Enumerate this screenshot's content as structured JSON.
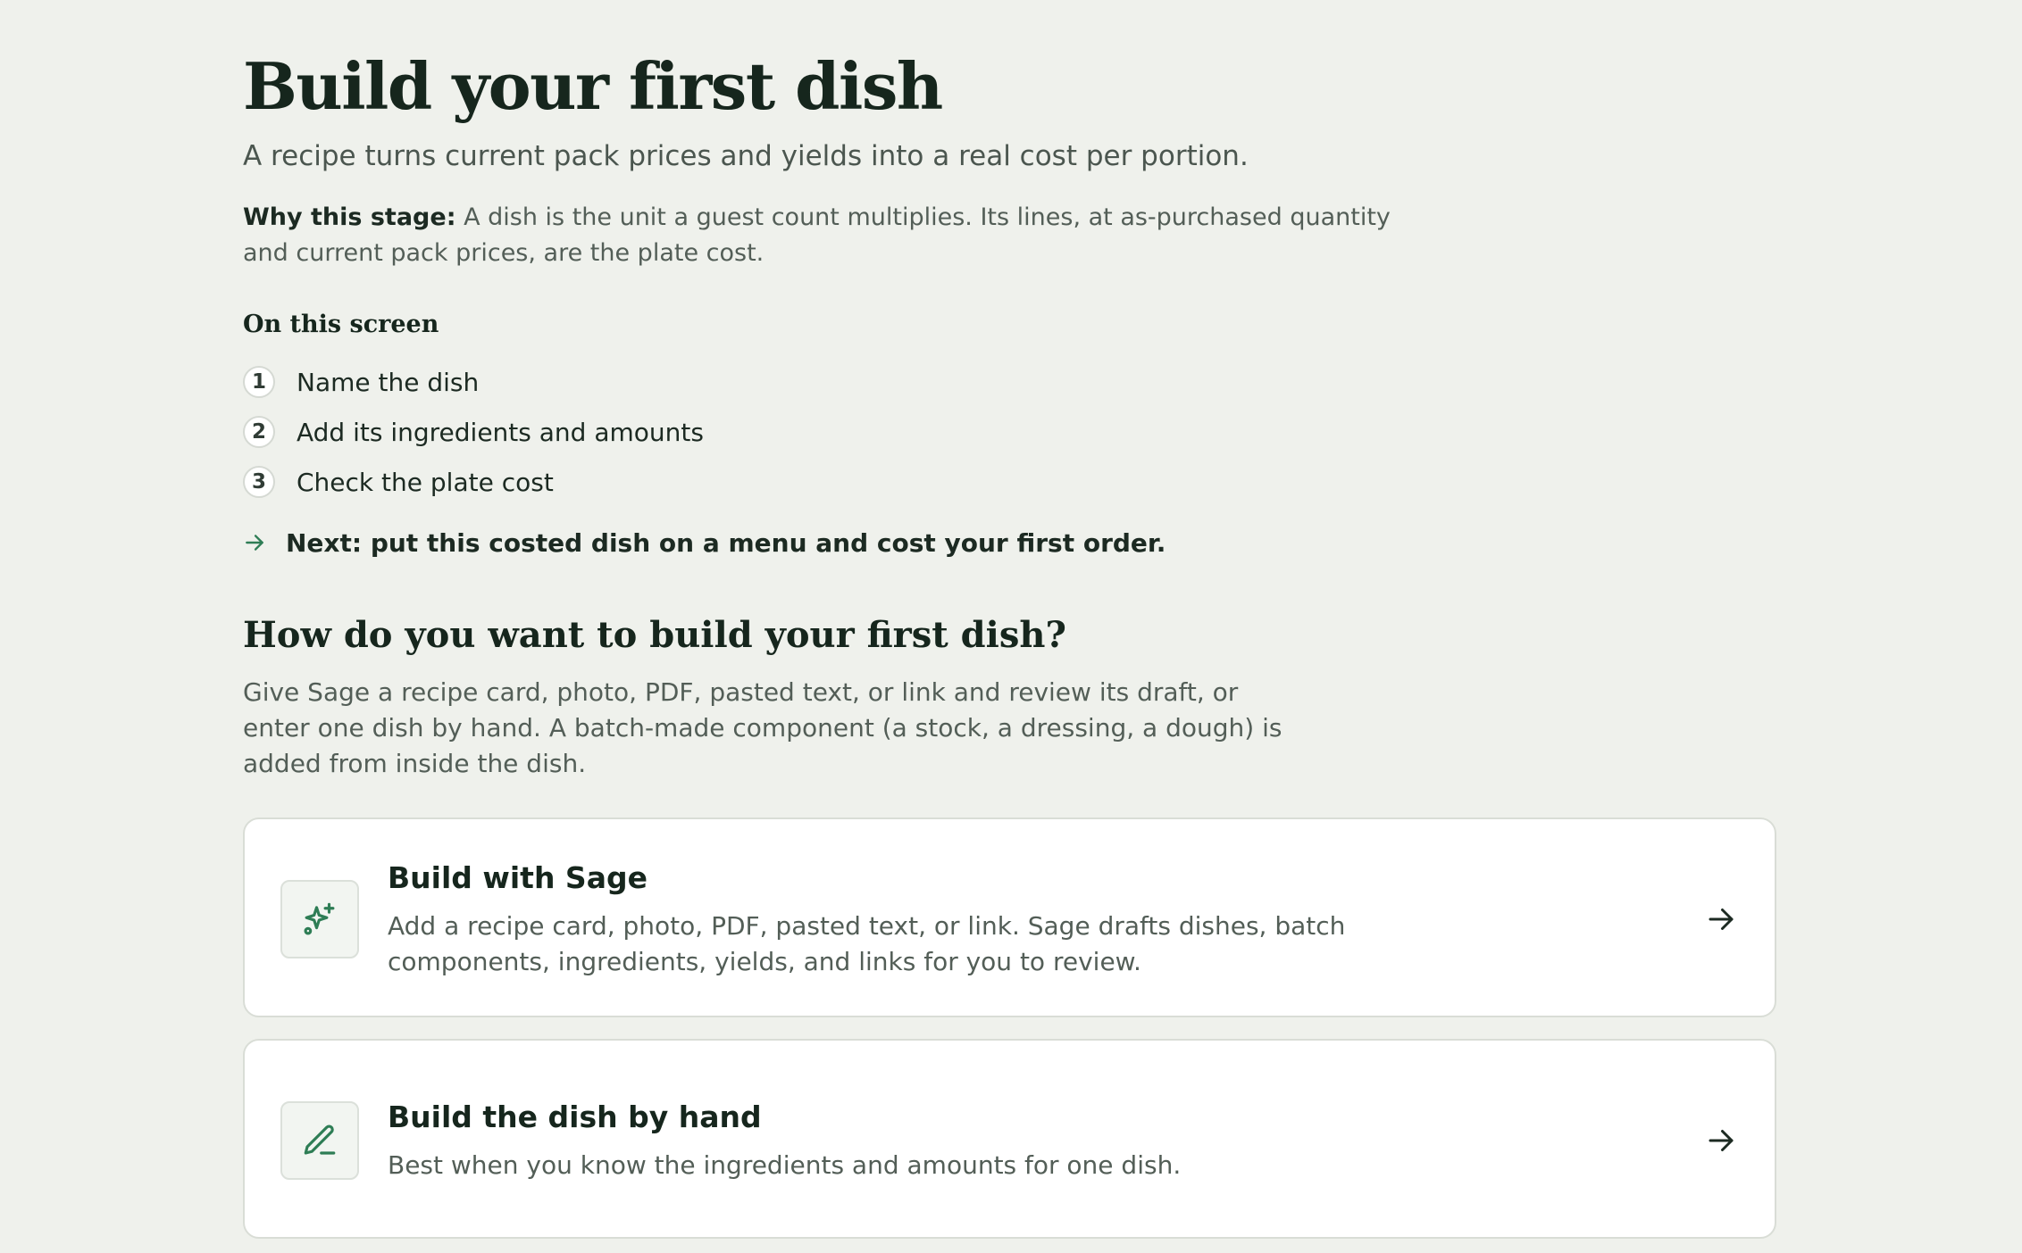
{
  "header": {
    "title": "Build your first dish",
    "subtitle": "A recipe turns current pack prices and yields into a real cost per portion."
  },
  "why": {
    "label": "Why this stage:",
    "text": " A dish is the unit a guest count multiplies. Its lines, at as-purchased quantity and current pack prices, are the plate cost."
  },
  "on_this_screen": {
    "heading": "On this screen",
    "steps": [
      {
        "number": "1",
        "label": "Name the dish"
      },
      {
        "number": "2",
        "label": "Add its ingredients and amounts"
      },
      {
        "number": "3",
        "label": "Check the plate cost"
      }
    ]
  },
  "next": {
    "text": "Next: put this costed dish on a menu and cost your first order.",
    "icon": "arrow-right-icon"
  },
  "question": {
    "heading": "How do you want to build your first dish?",
    "description": "Give Sage a recipe card, photo, PDF, pasted text, or link and review its draft, or enter one dish by hand. A batch-made component (a stock, a dressing, a dough) is added from inside the dish."
  },
  "options": [
    {
      "title": "Build with Sage",
      "description": "Add a recipe card, photo, PDF, pasted text, or link. Sage drafts dishes, batch components, ingredients, yields, and links for you to review.",
      "icon": "sparkles-icon"
    },
    {
      "title": "Build the dish by hand",
      "description": "Best when you know the ingredients and amounts for one dish.",
      "icon": "pencil-icon"
    }
  ],
  "colors": {
    "background": "#eff1ec",
    "accent": "#2e7d55",
    "heading": "#16261d",
    "muted_text": "#535e57"
  }
}
